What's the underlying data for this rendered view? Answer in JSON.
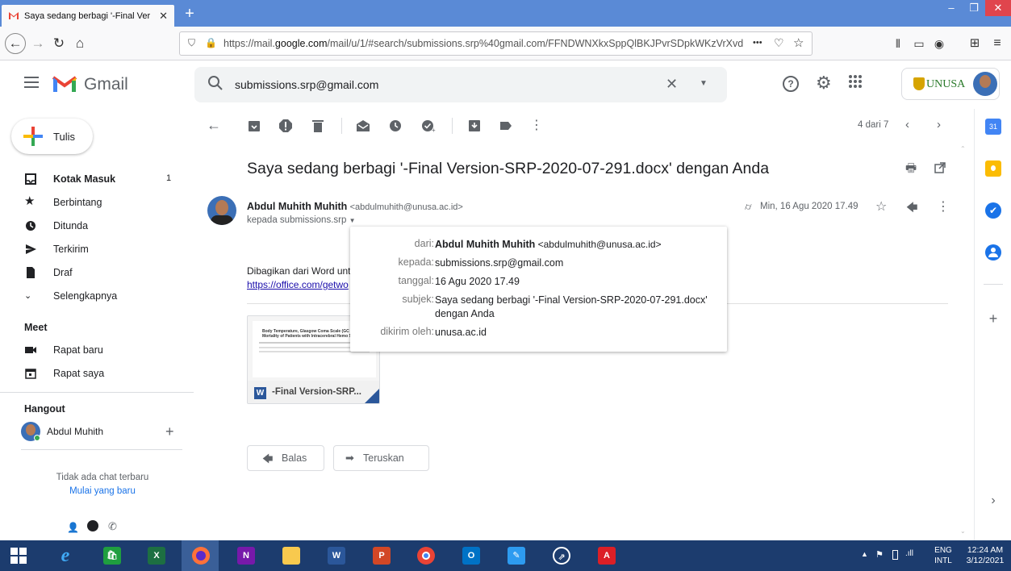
{
  "browser": {
    "tab_title": "Saya sedang berbagi '-Final Ver",
    "url_prefix": "https://mail.",
    "url_domain": "google.com",
    "url_rest": "/mail/u/1/#search/submissions.srp%40gmail.com/FFNDWNXkxSppQlBKJPvrSDpkWKzVrXvd",
    "url_more": "•••"
  },
  "gmail": {
    "app_name": "Gmail",
    "search_query": "submissions.srp@gmail.com",
    "org_name": "UNUSA"
  },
  "sidebar": {
    "compose_label": "Tulis",
    "items": [
      {
        "label": "Kotak Masuk",
        "count": "1",
        "icon": "inbox-icon"
      },
      {
        "label": "Berbintang",
        "count": "",
        "icon": "star-icon"
      },
      {
        "label": "Ditunda",
        "count": "",
        "icon": "clock-icon"
      },
      {
        "label": "Terkirim",
        "count": "",
        "icon": "send-icon"
      },
      {
        "label": "Draf",
        "count": "",
        "icon": "draft-icon"
      },
      {
        "label": "Selengkapnya",
        "count": "",
        "icon": "chevron-down-icon"
      }
    ],
    "meet_heading": "Meet",
    "meet_items": [
      {
        "label": "Rapat baru",
        "icon": "video-icon"
      },
      {
        "label": "Rapat saya",
        "icon": "calendar-icon"
      }
    ],
    "hangout_heading": "Hangout",
    "hangout_user": "Abdul Muhith",
    "no_chat": "Tidak ada chat terbaru",
    "start_new": "Mulai yang baru"
  },
  "toolbar": {
    "pagination": "4 dari 7"
  },
  "email": {
    "subject": "Saya sedang berbagi '-Final Version-SRP-2020-07-291.docx' dengan Anda",
    "sender_name": "Abdul Muhith Muhith",
    "sender_email": "<abdulmuhith@unusa.ac.id>",
    "recipient_line": "kepada submissions.srp",
    "date": "Min, 16 Agu 2020 17.49",
    "body_line1": "Dibagikan dari Word unt",
    "body_link": "https://office.com/getwo",
    "attachment_name": "-Final Version-SRP...",
    "attachment_preview_title": "Body Temperature, Glasgow Coma Scale (GC Mortality of Patients with Intracerebral Hemo Stroke"
  },
  "popover": {
    "rows": [
      {
        "key": "dari:",
        "name": "Abdul Muhith Muhith",
        "value": " <abdulmuhith@unusa.ac.id>"
      },
      {
        "key": "kepada:",
        "value": "submissions.srp@gmail.com"
      },
      {
        "key": "tanggal:",
        "value": "16 Agu 2020 17.49"
      },
      {
        "key": "subjek:",
        "value": "Saya sedang berbagi '-Final Version-SRP-2020-07-291.docx' dengan Anda"
      },
      {
        "key": "dikirim oleh:",
        "value": "unusa.ac.id"
      }
    ]
  },
  "actions": {
    "reply": "Balas",
    "forward": "Teruskan"
  },
  "taskbar": {
    "lang": "ENG",
    "layout": "INTL",
    "time": "12:24 AM",
    "date": "3/12/2021"
  },
  "colors": {
    "firefox_titlebar": "#5a8ad6",
    "gmail_red": "#ea4335",
    "taskbar": "#1c3c6e",
    "link": "#1a0dab"
  }
}
